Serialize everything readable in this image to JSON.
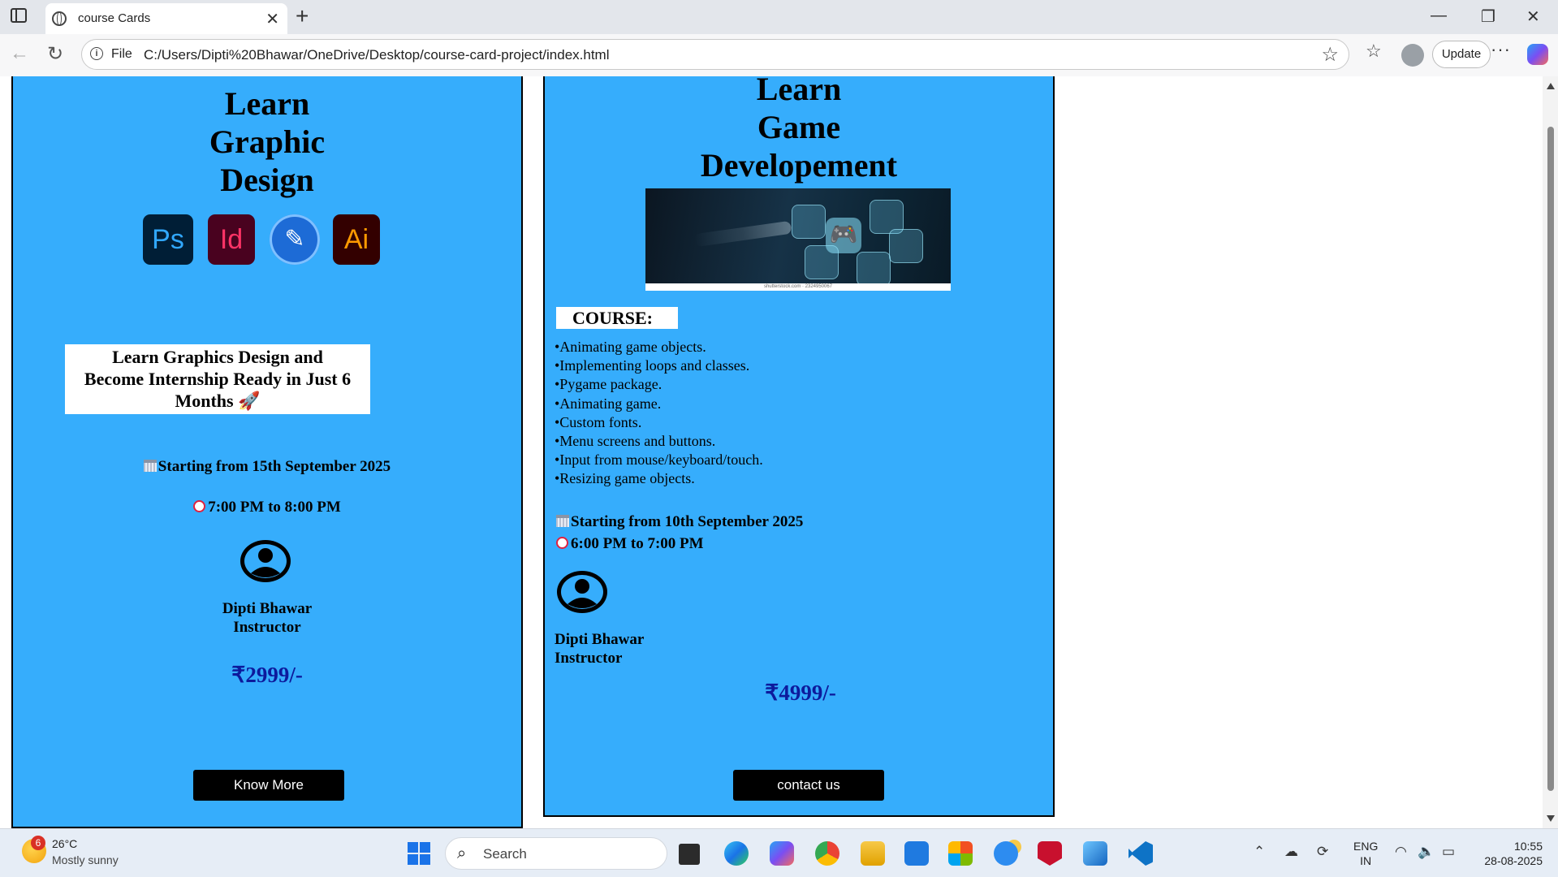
{
  "browser": {
    "tab_title": "course Cards",
    "address_protocol": "File",
    "address_url": "C:/Users/Dipti%20Bhawar/OneDrive/Desktop/course-card-project/index.html",
    "update_label": "Update"
  },
  "card1": {
    "title_lines": [
      "Learn",
      "Graphic",
      "Design"
    ],
    "apps": [
      "Ps",
      "Id",
      "Ai"
    ],
    "promo_line1": "Learn Graphics Design and",
    "promo_line2": "Become Internship Ready in Just 6",
    "promo_line3": "Months 🚀",
    "start_date": "Starting from 15th September 2025",
    "time": "7:00 PM to 8:00 PM",
    "instructor_name": "Dipti Bhawar",
    "instructor_role": "Instructor",
    "price": "₹2999/-",
    "button_label": "Know More"
  },
  "card2": {
    "title_lines": [
      "Learn",
      "Game",
      "Developement"
    ],
    "image_caption": "shutterstock.com · 2324950067",
    "course_heading": "COURSE:",
    "topics": [
      "•Animating game objects.",
      "•Implementing loops and classes.",
      "•Pygame package.",
      "•Animating game.",
      "•Custom fonts.",
      "•Menu screens and buttons.",
      "•Input from mouse/keyboard/touch.",
      "•Resizing game objects."
    ],
    "start_date": "Starting from 10th September 2025",
    "time": "6:00 PM to 7:00 PM",
    "instructor_name": "Dipti Bhawar",
    "instructor_role": "Instructor",
    "price": "₹4999/-",
    "button_label": "contact us"
  },
  "taskbar": {
    "weather_badge": "6",
    "temperature": "26°C",
    "weather_desc": "Mostly sunny",
    "search_label": "Search",
    "lang_line1": "ENG",
    "lang_line2": "IN",
    "time": "10:55",
    "date": "28-08-2025"
  },
  "colors": {
    "card_bg": "#36adfc",
    "price": "#0d1a9c",
    "button_bg": "#000000"
  }
}
